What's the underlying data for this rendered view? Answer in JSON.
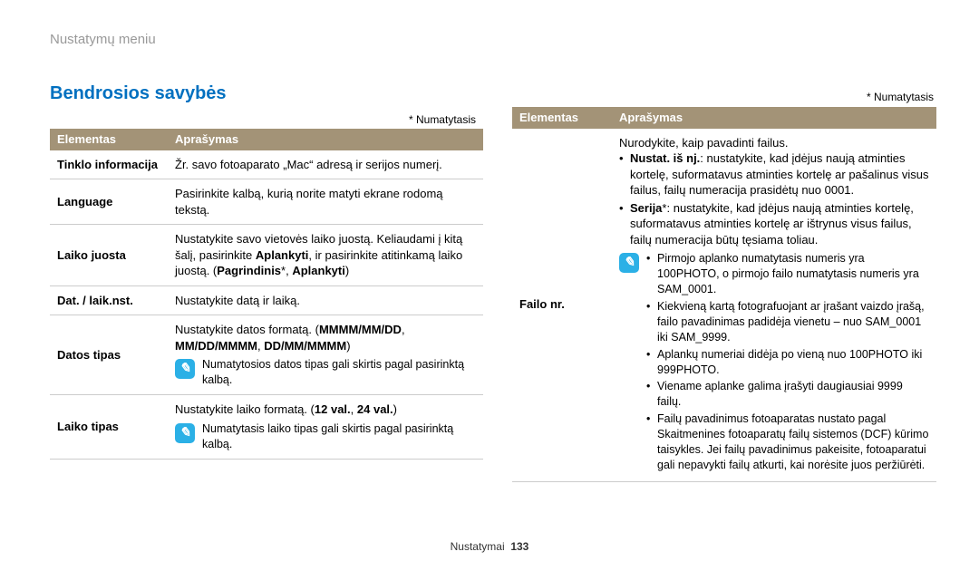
{
  "page_title": "Nustatymų meniu",
  "section_heading": "Bendrosios savybės",
  "default_note": "* Numatytasis",
  "headers": {
    "element": "Elementas",
    "description": "Aprašymas"
  },
  "left_table": [
    {
      "elem": "Tinklo informacija",
      "desc": "Žr. savo fotoaparato „Mac“ adresą ir serijos numerį."
    },
    {
      "elem": "Language",
      "desc": "Pasirinkite kalbą, kurią norite matyti ekrane rodomą tekstą."
    },
    {
      "elem": "Laiko juosta",
      "desc_pre": "Nustatykite savo vietovės laiko juostą. Keliaudami į kitą šalį, pasirinkite ",
      "bold1": "Aplankyti",
      "desc_mid": ", ir pasirinkite atitinkamą laiko juostą. (",
      "bold2": "Pagrindinis",
      "comma": "*, ",
      "bold3": "Aplankyti",
      "desc_end": ")"
    },
    {
      "elem": "Dat. / laik.nst.",
      "desc": "Nustatykite datą ir laiką."
    },
    {
      "elem": "Datos tipas",
      "desc_pre": "Nustatykite datos formatą. (",
      "bold1": "MMMM/MM/DD",
      "comma1": ", ",
      "bold2": "MM/DD/MMMM",
      "comma2": ", ",
      "bold3": "DD/MM/MMMM",
      "desc_end": ")",
      "note": "Numatytosios datos tipas gali skirtis pagal pasirinktą kalbą."
    },
    {
      "elem": "Laiko tipas",
      "desc_pre": "Nustatykite laiko formatą. (",
      "bold1": "12 val.",
      "comma1": ", ",
      "bold2": "24 val.",
      "desc_end": ")",
      "note": "Numatytasis laiko tipas gali skirtis pagal pasirinktą kalbą."
    }
  ],
  "right_table": {
    "elem": "Failo nr.",
    "intro": "Nurodykite, kaip pavadinti failus.",
    "bullets": [
      {
        "bold": "Nustat. iš nj.",
        "text": ": nustatykite, kad įdėjus naują atminties kortelę, suformatavus atminties kortelę ar pašalinus visus failus, failų numeracija prasidėtų nuo 0001."
      },
      {
        "bold": "Serija",
        "star": "*",
        "text": ": nustatykite, kad įdėjus naują atminties kortelę, suformatavus atminties kortelę ar ištrynus visus failus, failų numeracija būtų tęsiama toliau."
      }
    ],
    "notes": [
      "Pirmojo aplanko numatytasis numeris yra 100PHOTO, o pirmojo failo numatytasis numeris yra SAM_0001.",
      "Kiekvieną kartą fotografuojant ar įrašant vaizdo įrašą, failo pavadinimas padidėja vienetu – nuo SAM_0001 iki SAM_9999.",
      "Aplankų numeriai didėja po vieną nuo 100PHOTO iki 999PHOTO.",
      "Viename aplanke galima įrašyti daugiausiai 9999 failų.",
      "Failų pavadinimus fotoaparatas nustato pagal Skaitmenines fotoaparatų failų sistemos (DCF) kūrimo taisykles. Jei failų pavadinimus pakeisite, fotoaparatui gali nepavykti failų atkurti, kai norėsite juos peržiūrėti."
    ]
  },
  "footer": {
    "label": "Nustatymai",
    "pageno": "133"
  }
}
